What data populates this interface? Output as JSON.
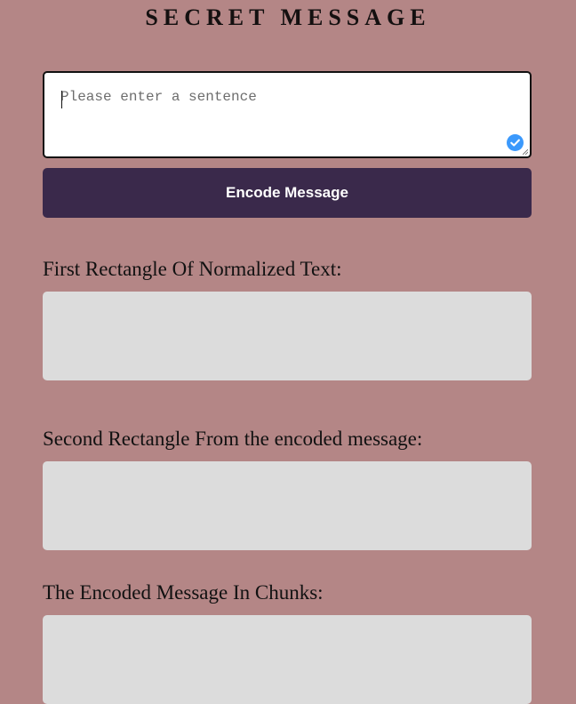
{
  "title": "SECRET MESSAGE",
  "input": {
    "placeholder": "Please enter a sentence",
    "value": "",
    "status_icon": "check-circle-icon",
    "status_color": "#3b99fc"
  },
  "encode_button": {
    "label": "Encode Message",
    "background": "#3a294b"
  },
  "sections": {
    "first": {
      "label": "First Rectangle Of Normalized Text:",
      "value": ""
    },
    "second": {
      "label": "Second Rectangle From the encoded message:",
      "value": ""
    },
    "third": {
      "label": "The Encoded Message In Chunks:",
      "value": ""
    }
  },
  "colors": {
    "page_background": "#b48686",
    "output_background": "#dcdcdc"
  }
}
